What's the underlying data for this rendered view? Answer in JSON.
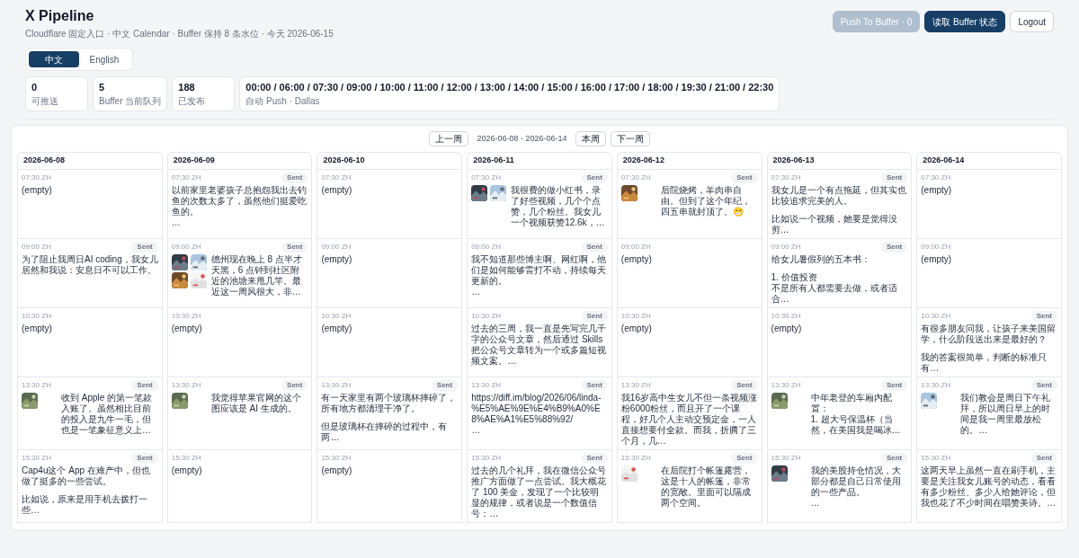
{
  "header": {
    "title": "X Pipeline",
    "subtitle": "Cloudflare 固定入口 · 中文 Calendar · Buffer 保持 8 条水位 · 今天 2026-06-15"
  },
  "actions": [
    {
      "label": "Push To Buffer · 0",
      "kind": "muted",
      "disabled": true
    },
    {
      "label": "读取 Buffer 状态",
      "kind": "primary",
      "disabled": false
    },
    {
      "label": "Logout",
      "kind": "outline",
      "disabled": false
    }
  ],
  "language_tabs": [
    {
      "label": "中文",
      "selected": true
    },
    {
      "label": "English",
      "selected": false
    }
  ],
  "stats": [
    {
      "value": "0",
      "label": "可推送"
    },
    {
      "value": "5",
      "label": "Buffer 当前队列"
    },
    {
      "value": "188",
      "label": "已发布"
    },
    {
      "value": "00:00 / 06:00 / 07:30 / 09:00 / 10:00 / 11:00 / 12:00 / 13:00 / 14:00 / 15:00 / 16:00 / 17:00 / 18:00 / 19:30 / 21:00 / 22:30",
      "label": "自动 Push · Dallas"
    }
  ],
  "week_nav": {
    "previous": "上一周",
    "range": "2026-06-08 - 2026-06-14",
    "current": "本周",
    "next": "下一周"
  },
  "days": [
    {
      "date": "2026-06-08",
      "slots": [
        {
          "time": "07:30 ZH",
          "text": "(empty)"
        },
        {
          "time": "09:00 ZH",
          "badge": "Sent",
          "text": "为了阻止我周日AI coding，我女儿居然和我说：安息日不可以工作。"
        },
        {
          "time": "10:30 ZH",
          "text": "(empty)"
        },
        {
          "time": "13:30 ZH",
          "badge": "Sent",
          "media": [
            {
              "kind": "picture"
            }
          ],
          "text": "收到 Apple 的第一笔款入账了。虽然相比目前的投入是九牛一毛，但也是一笔象征意义上…"
        },
        {
          "time": "15:30 ZH",
          "badge": "Sent",
          "paragraphs": [
            [
              "Cap4u这个 App 在难产中，但也做了挺多的一些尝试。"
            ],
            [
              "比如说，原来是用手机去拨打一些…"
            ]
          ]
        }
      ]
    },
    {
      "date": "2026-06-09",
      "slots": [
        {
          "time": "07:30 ZH",
          "badge": "Sent",
          "paragraphs": [
            [
              "以前家里老婆孩子总抱怨我出去钓鱼的次数太多了，虽然他们挺爱吃鱼的。",
              "…"
            ]
          ]
        },
        {
          "time": "09:00 ZH",
          "badge": "Sent",
          "media": [
            {
              "kind": "picture"
            },
            {
              "kind": "picture"
            },
            {
              "kind": "picture"
            },
            {
              "kind": "picture"
            }
          ],
          "text": "德州现在晚上 8 点半才天黑，6 点钟到社区附近的池塘来甩几竿。最近这一周风很大，非…"
        },
        {
          "time": "10:30 ZH",
          "text": "(empty)"
        },
        {
          "time": "13:30 ZH",
          "badge": "Sent",
          "media": [
            {
              "kind": "picture"
            }
          ],
          "text": "我觉得苹果官网的这个图应该是 AI 生成的。"
        },
        {
          "time": "15:30 ZH",
          "text": "(empty)"
        }
      ]
    },
    {
      "date": "2026-06-10",
      "slots": [
        {
          "time": "07:30 ZH",
          "text": "(empty)"
        },
        {
          "time": "09:00 ZH",
          "text": "(empty)"
        },
        {
          "time": "10:30 ZH",
          "text": "(empty)"
        },
        {
          "time": "13:30 ZH",
          "badge": "Sent",
          "paragraphs": [
            [
              "有一天家里有两个玻璃杯摔碎了，所有地方都清理干净了。"
            ],
            [
              "但是玻璃杯在摔碎的过程中，有两…"
            ]
          ]
        },
        {
          "time": "15:30 ZH",
          "text": "(empty)"
        }
      ]
    },
    {
      "date": "2026-06-11",
      "slots": [
        {
          "time": "07:30 ZH",
          "badge": "Sent",
          "media": [
            {
              "kind": "picture"
            },
            {
              "kind": "picture"
            }
          ],
          "text": "我很费的做小红书，录了好些视频，几个个点赞，几个粉丝。我女儿一个视频获赞12.6k，…"
        },
        {
          "time": "09:00 ZH",
          "badge": "Sent",
          "paragraphs": [
            [
              "我不知道那些博主啊、网红啊，他们是如何能够雷打不动，持续每天更新的。",
              "…"
            ]
          ]
        },
        {
          "time": "10:30 ZH",
          "badge": "Sent",
          "text": "过去的三周，我一直是先写完几千字的公众号文章，然后通过 Skills 把公众号文章转为一个或多篇短视频文案。…"
        },
        {
          "time": "13:30 ZH",
          "badge": "Sent",
          "kind": "link",
          "paragraphs": [
            [
              "https://diff.im/blog/2026/06/linda-%E5%AE%9E%E4%B9%A0%E8%AE%A1%E5%88%92/",
              "…"
            ]
          ]
        },
        {
          "time": "15:30 ZH",
          "badge": "Sent",
          "text": "过去的几个礼拜，我在微信公众号推广方面做了一点尝试。我大概花了 100 美金，发现了一个比较明显的规律，或者说是一个数值信号：…"
        }
      ]
    },
    {
      "date": "2026-06-12",
      "slots": [
        {
          "time": "07:30 ZH",
          "badge": "Sent",
          "media": [
            {
              "kind": "picture"
            }
          ],
          "text": "后院烧烤，羊肉串自由。但到了这个年纪，四五串就封顶了。😁"
        },
        {
          "time": "09:00 ZH",
          "text": "(empty)"
        },
        {
          "time": "10:30 ZH",
          "text": "(empty)"
        },
        {
          "time": "13:30 ZH",
          "badge": "Sent",
          "text": "我16岁高中生女儿不但一条视频涨粉6000粉丝，而且开了一个课程，好几个人主动交预定金，一人直接想要付全款。而我，折腾了三个月，几…"
        },
        {
          "time": "15:30 ZH",
          "badge": "Sent",
          "media": [
            {
              "kind": "picture"
            }
          ],
          "text": "在后院打个帐篷露营，这是十人的帐篷，非常的宽敞。里面可以隔成两个空间。"
        }
      ]
    },
    {
      "date": "2026-06-13",
      "slots": [
        {
          "time": "07:30 ZH",
          "badge": "Sent",
          "paragraphs": [
            [
              "我女儿是一个有点拖延，但其实也比较追求完美的人。"
            ],
            [
              "比如说一个视频，她要是觉得没剪…"
            ]
          ]
        },
        {
          "time": "09:00 ZH",
          "badge": "Sent",
          "paragraphs": [
            [
              "给女儿暑假列的五本书："
            ],
            [
              "1. 价值投资",
              "不是所有人都需要去做，或者适合…"
            ]
          ]
        },
        {
          "time": "10:30 ZH",
          "text": "(empty)"
        },
        {
          "time": "13:30 ZH",
          "badge": "Sent",
          "media": [
            {
              "kind": "picture"
            }
          ],
          "paragraphs": [
            [
              "中年老登的车厢内配置：",
              "1. 超大号保温杯（当然，在美国我是喝冰…"
            ]
          ]
        },
        {
          "time": "15:30 ZH",
          "badge": "Sent",
          "media": [
            {
              "kind": "picture"
            }
          ],
          "paragraphs": [
            [
              "我的美股持仓情况，大部分都是自己日常使用的一些产品。",
              "…"
            ]
          ]
        }
      ]
    },
    {
      "date": "2026-06-14",
      "slots": [
        {
          "time": "07:30 ZH",
          "text": "(empty)"
        },
        {
          "time": "09:00 ZH",
          "text": "(empty)"
        },
        {
          "time": "10:30 ZH",
          "badge": "Sent",
          "paragraphs": [
            [
              "有很多朋友问我，让孩子来美国留学，什么阶段送出来是最好的？"
            ],
            [
              "我的答案很简单，判断的标准只有…"
            ]
          ]
        },
        {
          "time": "13:30 ZH",
          "badge": "Sent",
          "media": [
            {
              "kind": "picture"
            }
          ],
          "text": "我们教会是周日下午礼拜，所以周日早上的时间是我一周里最放松的。…"
        },
        {
          "time": "15:30 ZH",
          "badge": "Sent",
          "text": "这两天早上虽然一直在刷手机，主要是关注我女儿账号的动态，看看有多少粉丝、多少人给她评论，但我也花了不少时间在唱赞美诗。…"
        }
      ]
    }
  ]
}
